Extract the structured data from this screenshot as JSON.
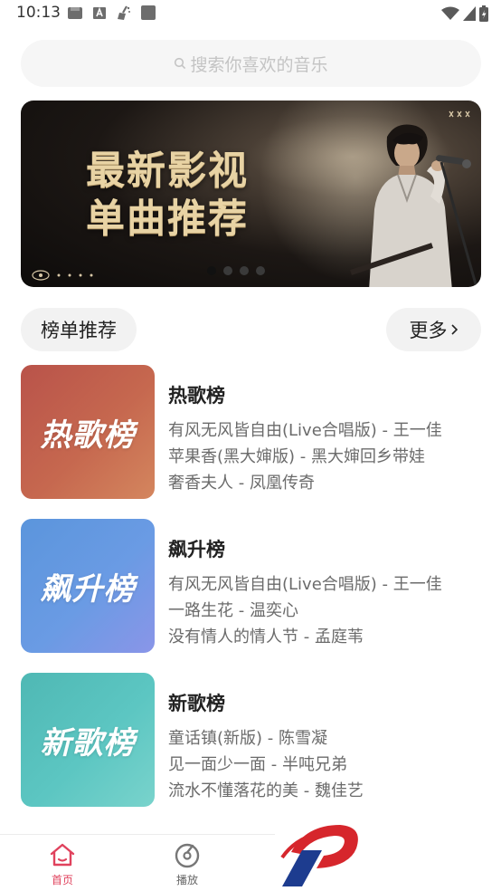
{
  "status_bar": {
    "time": "10:13",
    "icons_left": [
      "bag-icon",
      "font-a-icon",
      "broom-icon",
      "square-icon"
    ],
    "icons_right": [
      "wifi-icon",
      "signal-icon",
      "battery-icon"
    ]
  },
  "search": {
    "placeholder": "搜索你喜欢的音乐"
  },
  "banner": {
    "title_line1": "最新影视",
    "title_line2": "单曲推荐",
    "dot_count": 4,
    "active_dot": 0
  },
  "section": {
    "title": "榜单推荐",
    "more_label": "更多"
  },
  "charts": [
    {
      "title": "热歌榜",
      "cover_text": "热歌榜",
      "tracks": [
        "有风无风皆自由(Live合唱版) - 王一佳",
        "苹果香(黑大婶版) - 黑大婶回乡带娃",
        "奢香夫人 - 凤凰传奇"
      ]
    },
    {
      "title": "飙升榜",
      "cover_text": "飙升榜",
      "tracks": [
        "有风无风皆自由(Live合唱版) - 王一佳",
        "一路生花 - 温奕心",
        "没有情人的情人节 - 孟庭苇"
      ]
    },
    {
      "title": "新歌榜",
      "cover_text": "新歌榜",
      "tracks": [
        "童话镇(新版) - 陈雪凝",
        "见一面少一面 - 半吨兄弟",
        "流水不懂落花的美 - 魏佳艺"
      ]
    }
  ],
  "bottom_nav": {
    "items": [
      {
        "label": "首页",
        "icon": "home-icon",
        "active": true
      },
      {
        "label": "播放",
        "icon": "disc-icon",
        "active": false
      }
    ]
  },
  "colors": {
    "accent": "#e0425d",
    "hot_cover": "#c6684f",
    "rise_cover": "#6a9be4",
    "new_cover": "#5cc6c2"
  }
}
